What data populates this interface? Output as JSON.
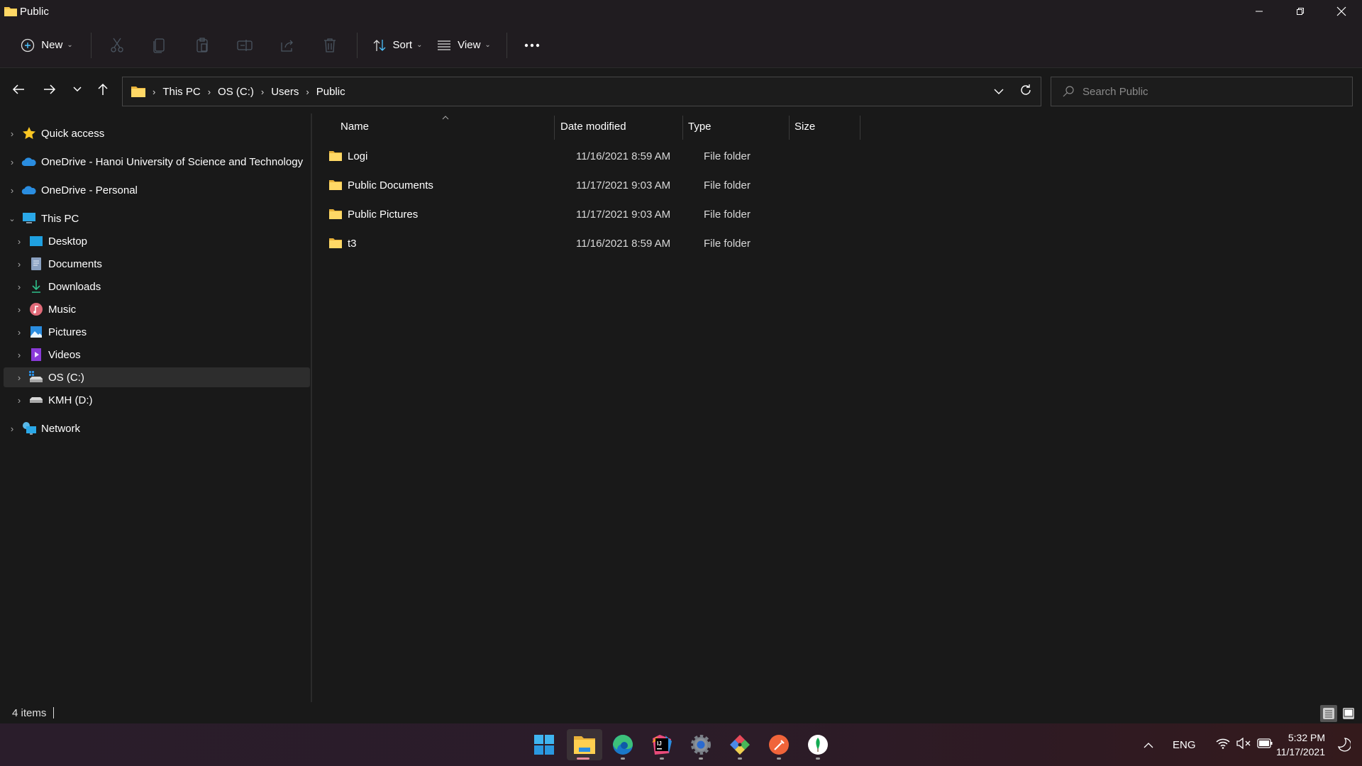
{
  "window": {
    "title": "Public",
    "controls": {
      "minimize": "minimize",
      "restore": "restore",
      "close": "close"
    }
  },
  "toolbar": {
    "new_label": "New",
    "sort_label": "Sort",
    "view_label": "View",
    "icons": [
      "cut-icon",
      "copy-icon",
      "paste-icon",
      "rename-icon",
      "share-icon",
      "delete-icon"
    ]
  },
  "navigation": {
    "breadcrumbs": [
      "This PC",
      "OS (C:)",
      "Users",
      "Public"
    ],
    "search_placeholder": "Search Public"
  },
  "sidebar": {
    "items": [
      {
        "label": "Quick access",
        "icon": "star-icon",
        "level": 0,
        "expanded": false
      },
      {
        "label": "OneDrive - Hanoi University of Science and Technology",
        "icon": "onedrive-icon",
        "level": 0,
        "expanded": false
      },
      {
        "label": "OneDrive - Personal",
        "icon": "onedrive-icon",
        "level": 0,
        "expanded": false
      },
      {
        "label": "This PC",
        "icon": "computer-icon",
        "level": 0,
        "expanded": true
      },
      {
        "label": "Desktop",
        "icon": "desktop-icon",
        "level": 1
      },
      {
        "label": "Documents",
        "icon": "documents-icon",
        "level": 1
      },
      {
        "label": "Downloads",
        "icon": "downloads-icon",
        "level": 1
      },
      {
        "label": "Music",
        "icon": "music-icon",
        "level": 1
      },
      {
        "label": "Pictures",
        "icon": "pictures-icon",
        "level": 1
      },
      {
        "label": "Videos",
        "icon": "videos-icon",
        "level": 1
      },
      {
        "label": "OS (C:)",
        "icon": "os-drive-icon",
        "level": 1,
        "selected": true
      },
      {
        "label": "KMH (D:)",
        "icon": "drive-icon",
        "level": 1
      },
      {
        "label": "Network",
        "icon": "network-icon",
        "level": 0,
        "expanded": false
      }
    ]
  },
  "file_list": {
    "columns": [
      "Name",
      "Date modified",
      "Type",
      "Size"
    ],
    "sorted_by": "Name",
    "rows": [
      {
        "name": "Logi",
        "date": "11/16/2021 8:59 AM",
        "type": "File folder",
        "size": ""
      },
      {
        "name": "Public Documents",
        "date": "11/17/2021 9:03 AM",
        "type": "File folder",
        "size": ""
      },
      {
        "name": "Public Pictures",
        "date": "11/17/2021 9:03 AM",
        "type": "File folder",
        "size": ""
      },
      {
        "name": "t3",
        "date": "11/16/2021 8:59 AM",
        "type": "File folder",
        "size": ""
      }
    ]
  },
  "status": {
    "item_count": "4 items"
  },
  "taskbar": {
    "apps": [
      "start",
      "file-explorer",
      "edge",
      "intellij",
      "settings",
      "git-tool",
      "postman",
      "mongodb-compass"
    ],
    "active_app": "file-explorer",
    "tray": {
      "language": "ENG",
      "time": "5:32 PM",
      "date": "11/17/2021"
    }
  },
  "colors": {
    "folder": "#f5c64a",
    "accent": "#4cc2ff",
    "background": "#191919",
    "toolbar": "#201c20"
  }
}
